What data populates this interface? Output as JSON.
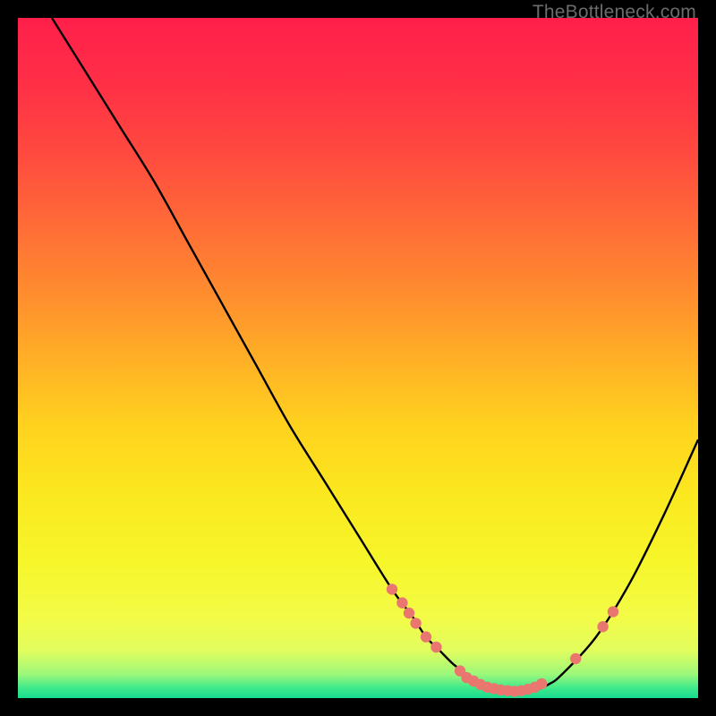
{
  "attribution": "TheBottleneck.com",
  "chart_data": {
    "type": "line",
    "title": "",
    "xlabel": "",
    "ylabel": "",
    "xlim": [
      0,
      100
    ],
    "ylim": [
      0,
      100
    ],
    "grid": false,
    "legend": false,
    "curve": {
      "name": "bottleneck-curve",
      "x": [
        5,
        10,
        15,
        20,
        25,
        30,
        35,
        40,
        45,
        50,
        55,
        58,
        60,
        62,
        64,
        66,
        68,
        70,
        72,
        74,
        76,
        78,
        80,
        85,
        90,
        95,
        100
      ],
      "y": [
        100,
        92,
        84,
        76,
        67,
        58,
        49,
        40,
        32,
        24,
        16,
        12,
        9,
        7,
        5,
        3.5,
        2.3,
        1.5,
        1,
        1,
        1.2,
        2,
        3.5,
        9,
        17,
        27,
        38
      ]
    },
    "markers": {
      "name": "marker-points",
      "color": "#e9776f",
      "points": [
        {
          "x": 55.0,
          "y": 16.0
        },
        {
          "x": 56.5,
          "y": 14.0
        },
        {
          "x": 57.5,
          "y": 12.5
        },
        {
          "x": 58.5,
          "y": 11.0
        },
        {
          "x": 60.0,
          "y": 9.0
        },
        {
          "x": 61.5,
          "y": 7.5
        },
        {
          "x": 65.0,
          "y": 4.0
        },
        {
          "x": 66.0,
          "y": 3.0
        },
        {
          "x": 67.0,
          "y": 2.5
        },
        {
          "x": 68.0,
          "y": 2.0
        },
        {
          "x": 69.0,
          "y": 1.6
        },
        {
          "x": 70.0,
          "y": 1.4
        },
        {
          "x": 71.0,
          "y": 1.2
        },
        {
          "x": 72.0,
          "y": 1.1
        },
        {
          "x": 73.0,
          "y": 1.0
        },
        {
          "x": 74.0,
          "y": 1.1
        },
        {
          "x": 75.0,
          "y": 1.3
        },
        {
          "x": 76.0,
          "y": 1.6
        },
        {
          "x": 77.0,
          "y": 2.1
        },
        {
          "x": 82.0,
          "y": 5.8
        },
        {
          "x": 86.0,
          "y": 10.5
        },
        {
          "x": 87.5,
          "y": 12.7
        }
      ]
    },
    "gradient_bands": [
      {
        "stop": 0.0,
        "color": "#ff1f4a"
      },
      {
        "stop": 0.1,
        "color": "#ff3046"
      },
      {
        "stop": 0.2,
        "color": "#ff4a3f"
      },
      {
        "stop": 0.3,
        "color": "#ff6a37"
      },
      {
        "stop": 0.4,
        "color": "#ff8b2f"
      },
      {
        "stop": 0.5,
        "color": "#ffaf26"
      },
      {
        "stop": 0.6,
        "color": "#ffd21e"
      },
      {
        "stop": 0.7,
        "color": "#fbe81f"
      },
      {
        "stop": 0.8,
        "color": "#f6f62a"
      },
      {
        "stop": 0.88,
        "color": "#f3fb46"
      },
      {
        "stop": 0.93,
        "color": "#e2fd5e"
      },
      {
        "stop": 0.965,
        "color": "#9cf87a"
      },
      {
        "stop": 0.985,
        "color": "#3fe98b"
      },
      {
        "stop": 1.0,
        "color": "#18db8f"
      }
    ]
  }
}
